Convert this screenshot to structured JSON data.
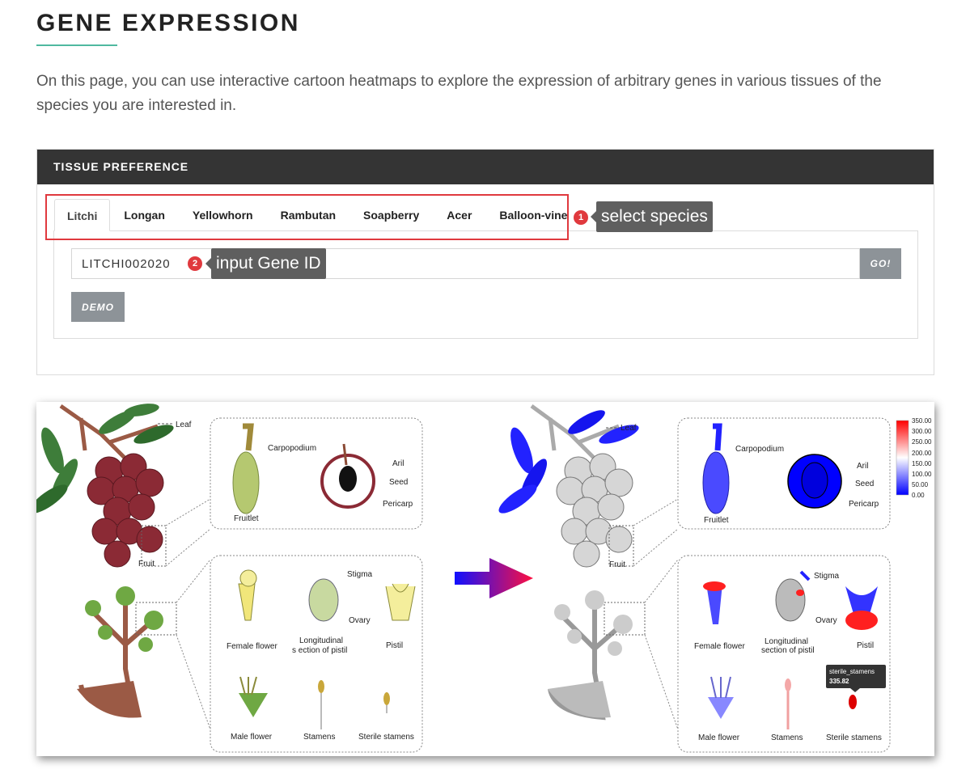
{
  "page": {
    "title": "GENE EXPRESSION",
    "intro": "On this page, you can use interactive cartoon heatmaps to explore the expression of arbitrary genes in various tissues of the species you are interested in."
  },
  "panel": {
    "header": "TISSUE PREFERENCE",
    "tabs": [
      "Litchi",
      "Longan",
      "Yellowhorn",
      "Rambutan",
      "Soapberry",
      "Acer",
      "Balloon-vine"
    ],
    "active_tab": "Litchi",
    "gene_input_value": "LITCHI002020",
    "go_label": "GO!",
    "demo_label": "DEMO"
  },
  "annotations": [
    {
      "number": "1",
      "text": "select species"
    },
    {
      "number": "2",
      "text": "input Gene ID"
    }
  ],
  "figure": {
    "left_labels": {
      "leaf": "Leaf",
      "fruit": "Fruit",
      "carpopodium": "Carpopodium",
      "fruitlet": "Fruitlet",
      "aril": "Aril",
      "seed": "Seed",
      "pericarp": "Pericarp",
      "stigma": "Stigma",
      "ovary": "Ovary",
      "female_flower": "Female flower",
      "long_section_1": "Longitudinal",
      "long_section_2": "s ection of pistil",
      "pistil": "Pistil",
      "male_flower": "Male flower",
      "stamens": "Stamens",
      "sterile_stamens": "Sterile stamens"
    },
    "right_labels": {
      "leaf": "Leaf",
      "fruit": "Fruit",
      "carpopodium": "Carpopodium",
      "fruitlet": "Fruitlet",
      "aril": "Aril",
      "seed": "Seed",
      "pericarp": "Pericarp",
      "stigma": "Stigma",
      "ovary": "Ovary",
      "female_flower": "Female flower",
      "long_section_1": "Longitudinal",
      "long_section_2": "section of pistil",
      "pistil": "Pistil",
      "male_flower": "Male flower",
      "stamens": "Stamens",
      "sterile_stamens": "Sterile stamens"
    },
    "legend_ticks": [
      "350.00",
      "300.00",
      "250.00",
      "200.00",
      "150.00",
      "100.00",
      "50.00",
      "0.00"
    ],
    "tooltip": {
      "name": "sterile_stamens",
      "value": "335.82"
    },
    "colors": {
      "high": "#ff0000",
      "mid": "#ffffff",
      "low": "#0000ff",
      "fruit_dark": "#8b2a35",
      "leaf_green": "#3e7d3a",
      "branch_brown": "#9b5a45"
    }
  }
}
